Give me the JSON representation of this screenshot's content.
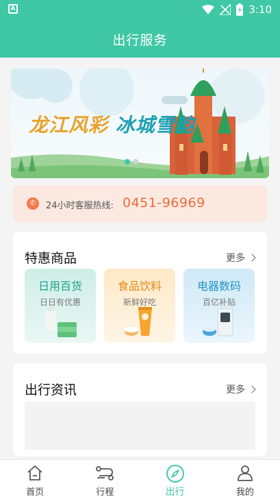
{
  "status_bar": {
    "time": "3:10",
    "left_badge": "A"
  },
  "header": {
    "title": "出行服务"
  },
  "banner": {
    "text_part1": "龙江风彩",
    "text_part2": "冰城雪韵"
  },
  "hotline": {
    "label": "24小时客服热线:",
    "number": "0451-96969"
  },
  "deals": {
    "title": "特惠商品",
    "more": "更多",
    "tiles": [
      {
        "name": "日用百货",
        "sub": "日日有优惠"
      },
      {
        "name": "食品饮料",
        "sub": "新鲜好吃"
      },
      {
        "name": "电器数码",
        "sub": "百亿补贴"
      }
    ]
  },
  "news": {
    "title": "出行资讯",
    "more": "更多"
  },
  "tabbar": {
    "items": [
      {
        "label": "首页",
        "icon": "home-icon"
      },
      {
        "label": "行程",
        "icon": "route-icon"
      },
      {
        "label": "出行",
        "icon": "compass-icon"
      },
      {
        "label": "我的",
        "icon": "user-icon"
      }
    ],
    "active_index": 2
  },
  "colors": {
    "primary": "#40c8a6",
    "hotline": "#ee6b3a"
  }
}
